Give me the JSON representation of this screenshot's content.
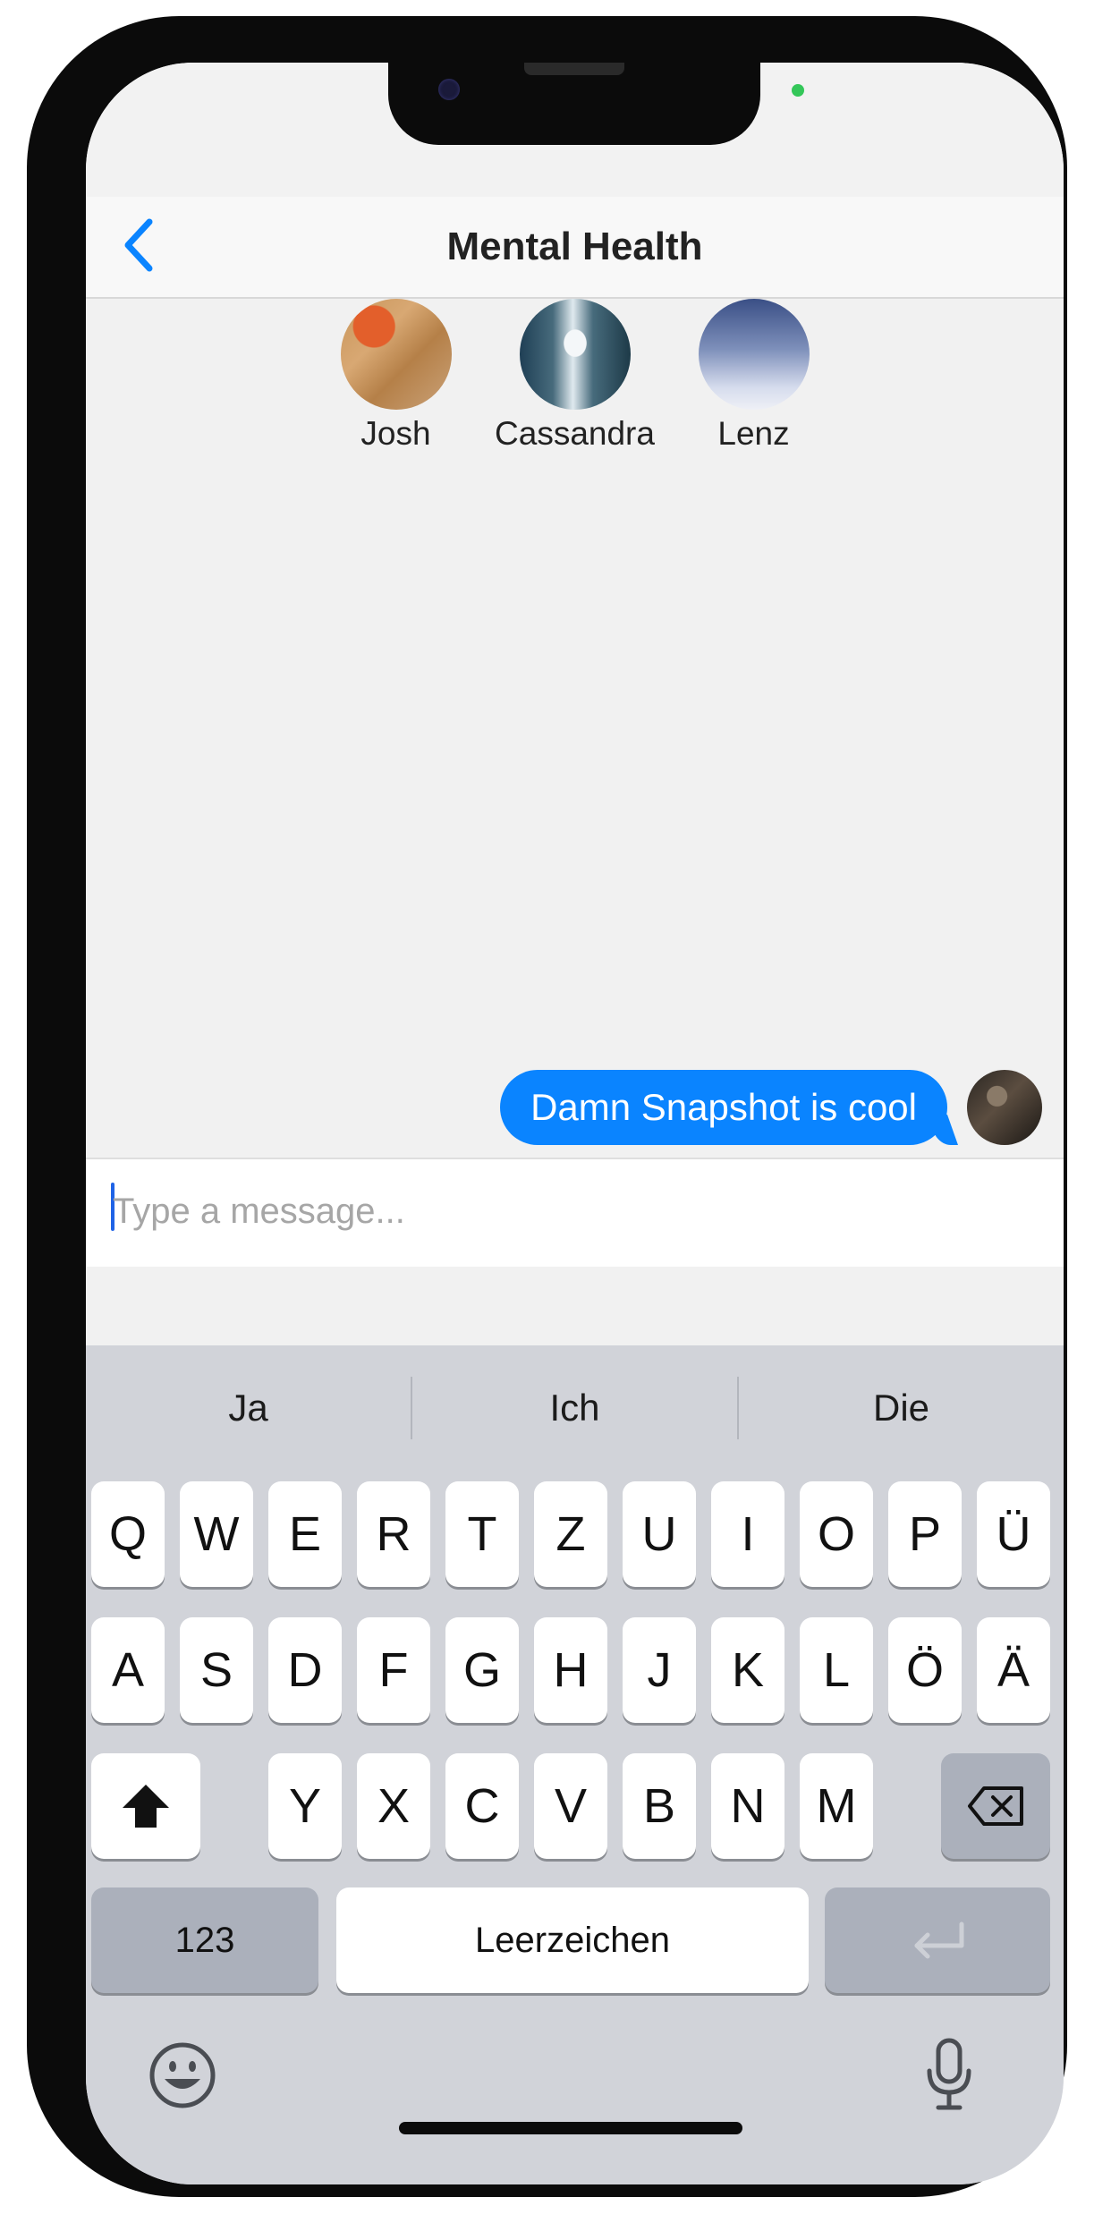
{
  "header": {
    "title": "Mental Health"
  },
  "participants": [
    {
      "name": "Josh"
    },
    {
      "name": "Cassandra"
    },
    {
      "name": "Lenz"
    }
  ],
  "messages": [
    {
      "text": "Damn Snapshot is cool",
      "sender": "me"
    }
  ],
  "composer": {
    "placeholder": "Type a message...",
    "value": ""
  },
  "keyboard": {
    "suggestions": [
      "Ja",
      "Ich",
      "Die"
    ],
    "row1": [
      "Q",
      "W",
      "E",
      "R",
      "T",
      "Z",
      "U",
      "I",
      "O",
      "P",
      "Ü"
    ],
    "row2": [
      "A",
      "S",
      "D",
      "F",
      "G",
      "H",
      "J",
      "K",
      "L",
      "Ö",
      "Ä"
    ],
    "row3": [
      "Y",
      "X",
      "C",
      "V",
      "B",
      "N",
      "M"
    ],
    "numbers_label": "123",
    "space_label": "Leerzeichen"
  },
  "icons": [
    "back-chevron-icon",
    "shift-icon",
    "backspace-icon",
    "return-icon",
    "emoji-icon",
    "microphone-icon"
  ],
  "colors": {
    "accent": "#0a84ff",
    "bubble_text": "#ffffff",
    "keyboard_bg": "#d1d3d9",
    "status_dot": "#34c759"
  }
}
